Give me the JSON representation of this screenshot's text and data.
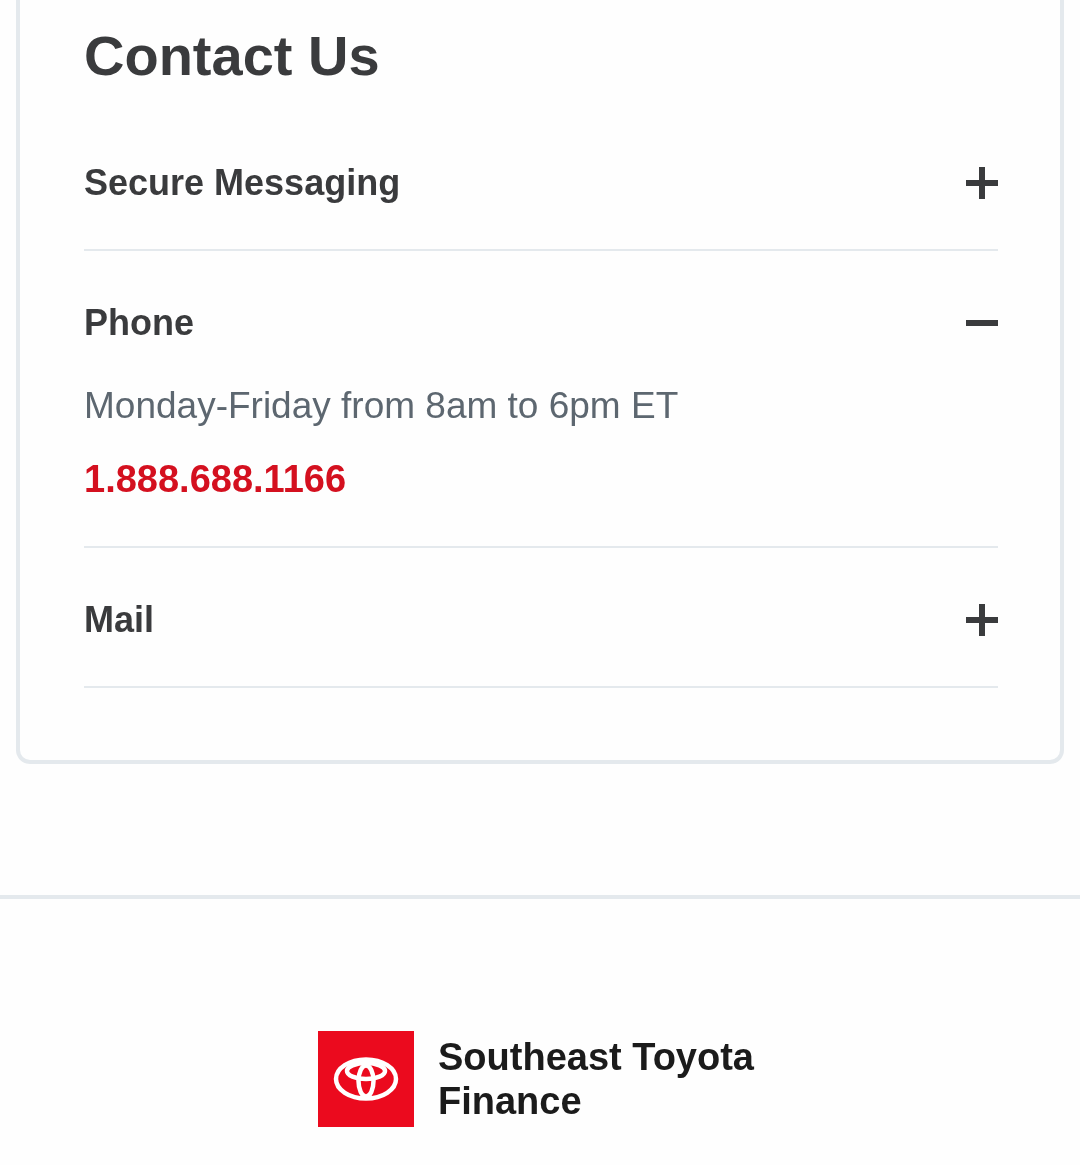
{
  "title": "Contact Us",
  "sections": [
    {
      "label": "Secure Messaging",
      "expanded": false
    },
    {
      "label": "Phone",
      "expanded": true,
      "hours": "Monday-Friday from 8am to 6pm ET",
      "phone": "1.888.688.1166"
    },
    {
      "label": "Mail",
      "expanded": false
    }
  ],
  "footer": {
    "brand": "Southeast Toyota Finance"
  }
}
